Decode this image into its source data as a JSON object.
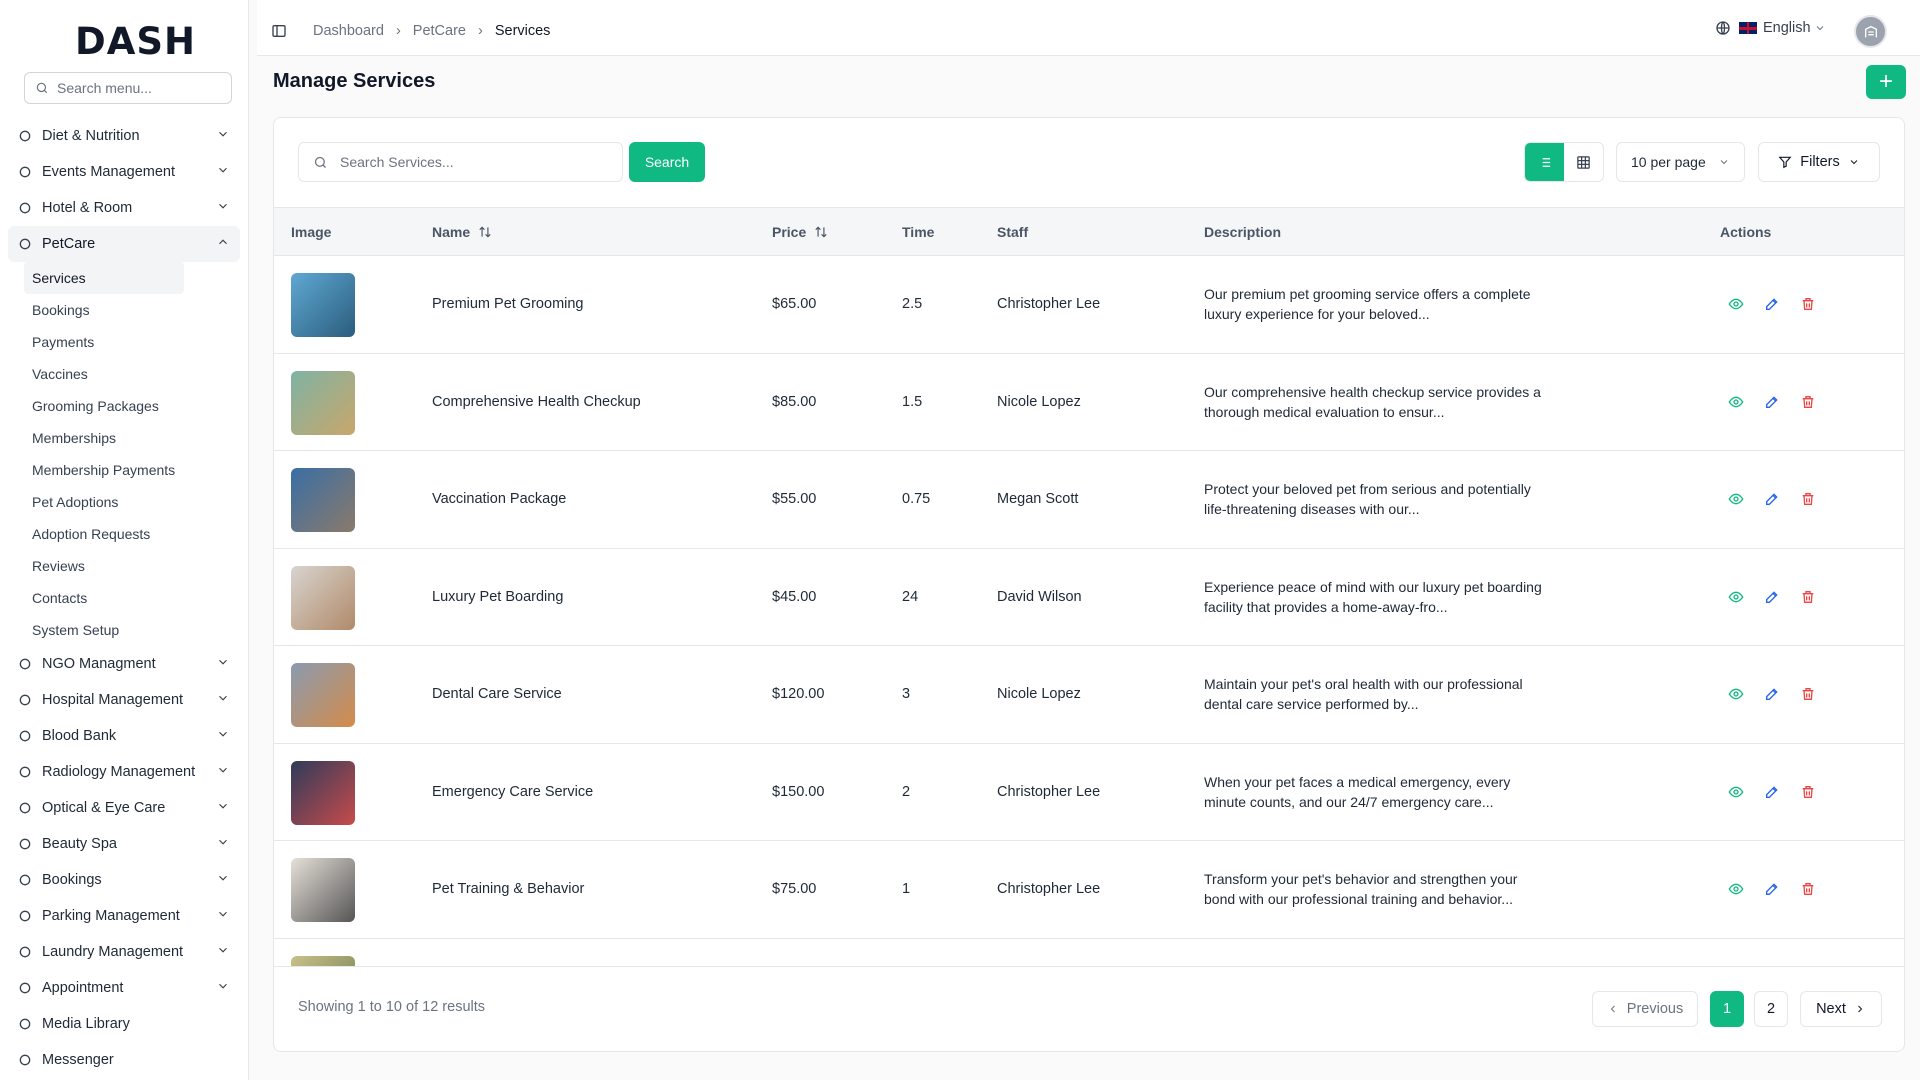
{
  "brand": {
    "logo_text": "DASH"
  },
  "sidebar": {
    "search_placeholder": "Search menu...",
    "items_top": [
      {
        "label": "Diet & Nutrition",
        "icon": "apple-icon"
      },
      {
        "label": "Events Management",
        "icon": "party-icon"
      },
      {
        "label": "Hotel & Room",
        "icon": "concierge-icon"
      }
    ],
    "petcare": {
      "label": "PetCare",
      "icon": "paw-icon"
    },
    "petcare_sub": [
      "Services",
      "Bookings",
      "Payments",
      "Vaccines",
      "Grooming Packages",
      "Memberships",
      "Membership Payments",
      "Pet Adoptions",
      "Adoption Requests",
      "Reviews",
      "Contacts",
      "System Setup"
    ],
    "items_bottom": [
      {
        "label": "NGO Managment",
        "icon": "hand-heart-icon",
        "chev": true
      },
      {
        "label": "Hospital Management",
        "icon": "stethoscope-icon",
        "chev": true
      },
      {
        "label": "Blood Bank",
        "icon": "droplet-icon",
        "chev": true
      },
      {
        "label": "Radiology Management",
        "icon": "radiology-icon",
        "chev": true
      },
      {
        "label": "Optical & Eye Care",
        "icon": "eye-icon",
        "chev": true
      },
      {
        "label": "Beauty Spa",
        "icon": "scissors-icon",
        "chev": true
      },
      {
        "label": "Bookings",
        "icon": "list-icon",
        "chev": true
      },
      {
        "label": "Parking Management",
        "icon": "grid-icon",
        "chev": true
      },
      {
        "label": "Laundry Management",
        "icon": "washer-icon",
        "chev": true
      },
      {
        "label": "Appointment",
        "icon": "calendar-icon",
        "chev": true
      },
      {
        "label": "Media Library",
        "icon": "image-icon",
        "chev": false
      },
      {
        "label": "Messenger",
        "icon": "chat-icon",
        "chev": false
      }
    ]
  },
  "topbar": {
    "breadcrumb": [
      "Dashboard",
      "PetCare",
      "Services"
    ],
    "language": "English"
  },
  "page": {
    "title": "Manage Services",
    "add_label": "+"
  },
  "toolbar": {
    "search_placeholder": "Search Services...",
    "search_label": "Search",
    "per_page": "10 per page",
    "filters_label": "Filters"
  },
  "table": {
    "columns": {
      "image": "Image",
      "name": "Name",
      "price": "Price",
      "time": "Time",
      "staff": "Staff",
      "description": "Description",
      "actions": "Actions"
    },
    "rows": [
      {
        "name": "Premium Pet Grooming",
        "price": "$65.00",
        "time": "2.5",
        "staff": "Christopher Lee",
        "description": "Our premium pet grooming service offers a complete luxury experience for your beloved..."
      },
      {
        "name": "Comprehensive Health Checkup",
        "price": "$85.00",
        "time": "1.5",
        "staff": "Nicole Lopez",
        "description": "Our comprehensive health checkup service provides a thorough medical evaluation to ensur..."
      },
      {
        "name": "Vaccination Package",
        "price": "$55.00",
        "time": "0.75",
        "staff": "Megan Scott",
        "description": "Protect your beloved pet from serious and potentially life-threatening diseases with our..."
      },
      {
        "name": "Luxury Pet Boarding",
        "price": "$45.00",
        "time": "24",
        "staff": "David Wilson",
        "description": "Experience peace of mind with our luxury pet boarding facility that provides a home-away-fro..."
      },
      {
        "name": "Dental Care Service",
        "price": "$120.00",
        "time": "3",
        "staff": "Nicole Lopez",
        "description": "Maintain your pet's oral health with our professional dental care service performed by..."
      },
      {
        "name": "Emergency Care Service",
        "price": "$150.00",
        "time": "2",
        "staff": "Christopher Lee",
        "description": "When your pet faces a medical emergency, every minute counts, and our 24/7 emergency care..."
      },
      {
        "name": "Pet Training & Behavior",
        "price": "$75.00",
        "time": "1",
        "staff": "Christopher Lee",
        "description": "Transform your pet's behavior and strengthen your bond with our professional training and behavior..."
      }
    ]
  },
  "footer": {
    "showing": "Showing 1 to 10 of 12 results",
    "prev": "Previous",
    "pages": [
      "1",
      "2"
    ],
    "next": "Next"
  },
  "colors": {
    "accent": "#10b981",
    "danger": "#ef4444",
    "edit": "#2563eb"
  }
}
